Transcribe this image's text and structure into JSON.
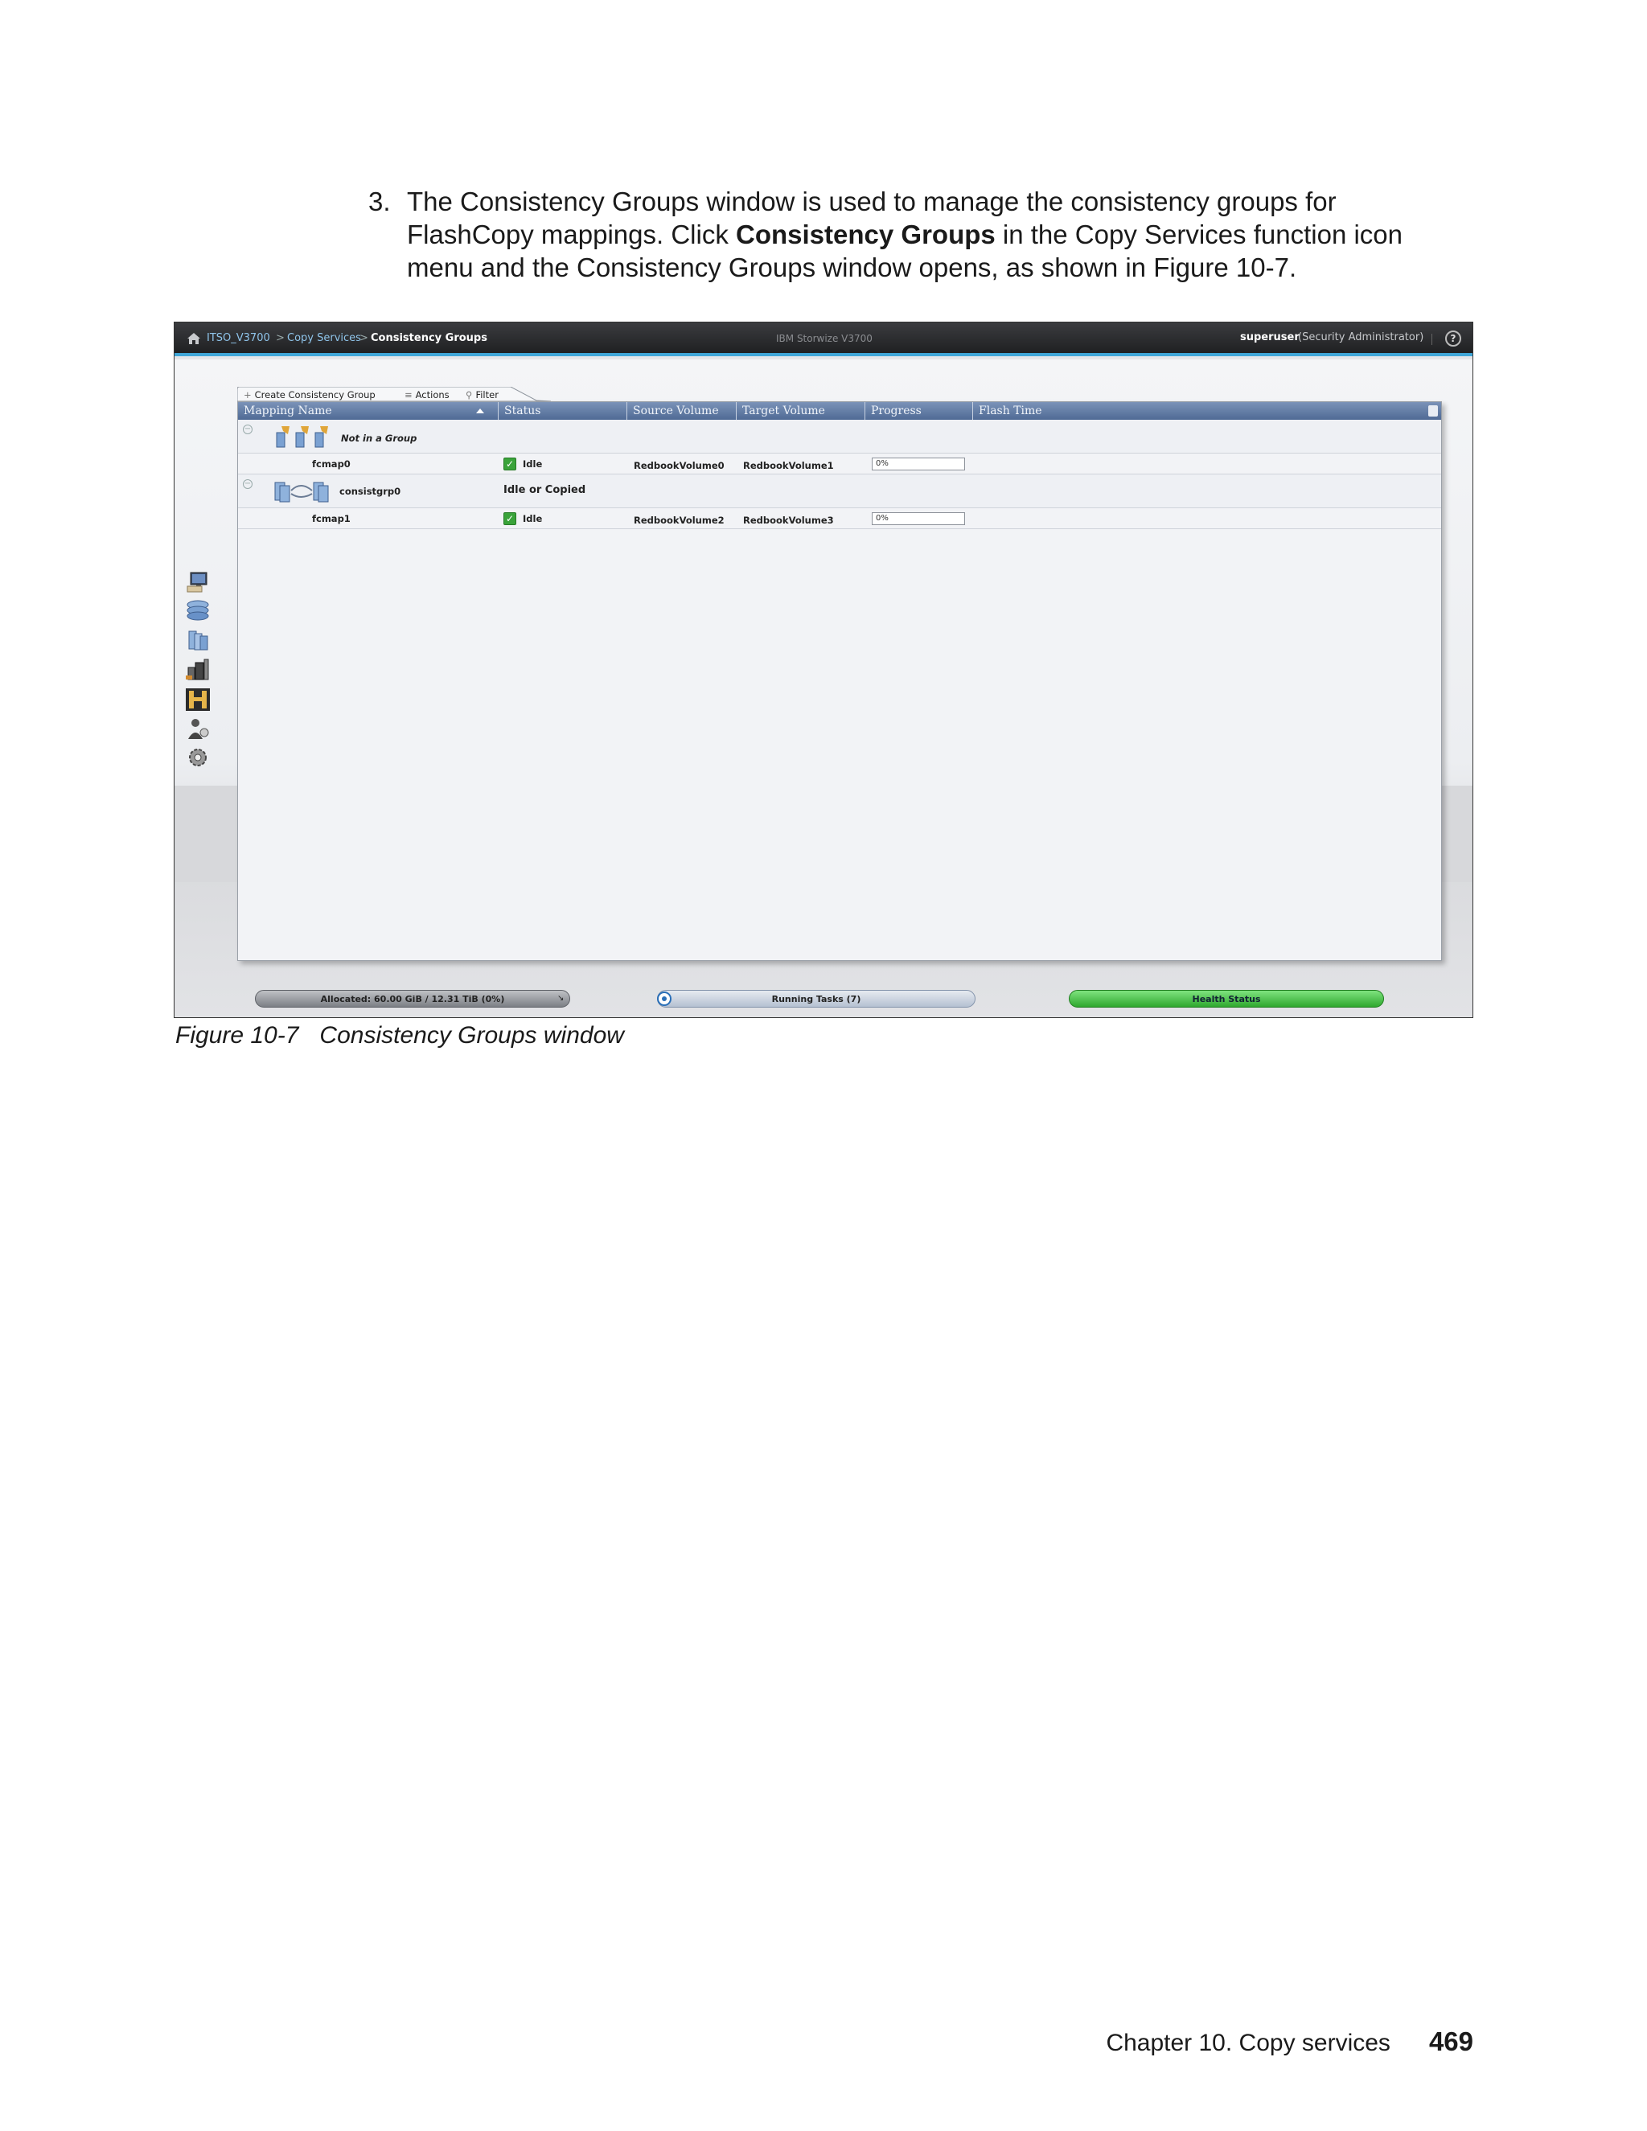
{
  "document": {
    "step_number": "3.",
    "step_text_before": "The Consistency Groups window is used to manage the consistency groups for FlashCopy mappings. Click ",
    "step_text_bold": "Consistency Groups",
    "step_text_after": " in the Copy Services function icon menu and the Consistency Groups window opens, as shown in Figure 10-7.",
    "figure_label": "Figure 10-7",
    "figure_title": "Consistency Groups window",
    "footer_chapter": "Chapter 10. Copy services",
    "page_number": "469"
  },
  "app": {
    "breadcrumb": [
      "ITSO_V3700",
      "Copy Services",
      "Consistency Groups"
    ],
    "breadcrumb_separator": ">",
    "product_name": "IBM Storwize V3700",
    "user_name": "superuser",
    "user_role": "(Security Administrator)",
    "help_label": "?",
    "accent_color": "#3fa6d8"
  },
  "toolbar": {
    "create_label": "Create Consistency Group",
    "actions_label": "Actions",
    "filter_label": "Filter"
  },
  "table": {
    "columns": [
      "Mapping Name",
      "Status",
      "Source Volume",
      "Target Volume",
      "Progress",
      "Flash Time"
    ],
    "groups": [
      {
        "name": "Not in a Group",
        "status": "",
        "mappings": [
          {
            "name": "fcmap0",
            "status": "Idle",
            "source": "RedbookVolume0",
            "target": "RedbookVolume1",
            "progress_label": "0%",
            "progress": 0
          }
        ]
      },
      {
        "name": "consistgrp0",
        "status": "Idle or Copied",
        "mappings": [
          {
            "name": "fcmap1",
            "status": "Idle",
            "source": "RedbookVolume2",
            "target": "RedbookVolume3",
            "progress_label": "0%",
            "progress": 0
          }
        ]
      }
    ]
  },
  "statusbar": {
    "allocated": "Allocated: 60.00 GiB / 12.31 TiB (0%)",
    "running_tasks": "Running Tasks (7)",
    "health": "Health Status",
    "health_color": "#3cb043"
  },
  "function_icons": [
    "monitoring-icon",
    "pools-icon",
    "volumes-icon",
    "hosts-icon",
    "copy-services-icon",
    "access-icon",
    "settings-icon"
  ]
}
